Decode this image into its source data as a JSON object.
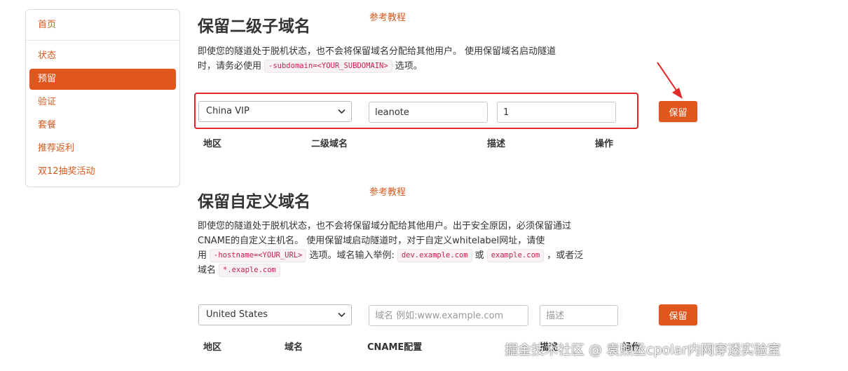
{
  "sidebar": {
    "home": "首页",
    "items": [
      {
        "label": "状态",
        "active": false
      },
      {
        "label": "预留",
        "active": true
      },
      {
        "label": "验证",
        "active": false
      },
      {
        "label": "套餐",
        "active": false
      },
      {
        "label": "推荐返利",
        "active": false
      },
      {
        "label": "双12抽奖活动",
        "active": false
      }
    ]
  },
  "subdomain_section": {
    "title": "保留二级子域名",
    "tutorial_link": "参考教程",
    "desc_line1": "即使您的隧道处于脱机状态，也不会将保留域名分配给其他用户。 使用保留域名启动隧道",
    "desc_line2_prefix": "时，请务必使用",
    "desc_code": "-subdomain=<YOUR_SUBDOMAIN>",
    "desc_line2_suffix": "选项。",
    "region_value": "China VIP",
    "subdomain_value": "leanote",
    "description_value": "1",
    "save_label": "保留",
    "columns": [
      "地区",
      "二级域名",
      "描述",
      "操作"
    ]
  },
  "custom_section": {
    "title": "保留自定义域名",
    "tutorial_link": "参考教程",
    "desc_line1": "即使您的隧道处于脱机状态，也不会将保留域分配给其他用户。出于安全原因，必须保留通过",
    "desc_line2": "CNAME的自定义主机名。 使用保留域启动隧道时，对于自定义whitelabel网址，请使",
    "desc_line3_prefix": "用",
    "desc_code1": "-hostname=<YOUR_URL>",
    "desc_line3_mid": "选项。域名输入举例:",
    "desc_code2": "dev.example.com",
    "desc_or": "或",
    "desc_code3": "example.com",
    "desc_line3_suffix": "，或者泛",
    "desc_line4_prefix": "域名",
    "desc_code4": "*.exaple.com",
    "region_value": "United States",
    "domain_placeholder": "域名 例如:www.example.com",
    "description_placeholder": "描述",
    "save_label": "保留",
    "columns": [
      "地区",
      "域名",
      "CNAME配置",
      "描述",
      "操作"
    ]
  },
  "watermark": "掘金技术社区 @ 袁煦丞cpolar内网穿透实验室",
  "colors": {
    "accent": "#e0561d",
    "link": "#d35a1f",
    "highlight": "#e02a2a"
  }
}
